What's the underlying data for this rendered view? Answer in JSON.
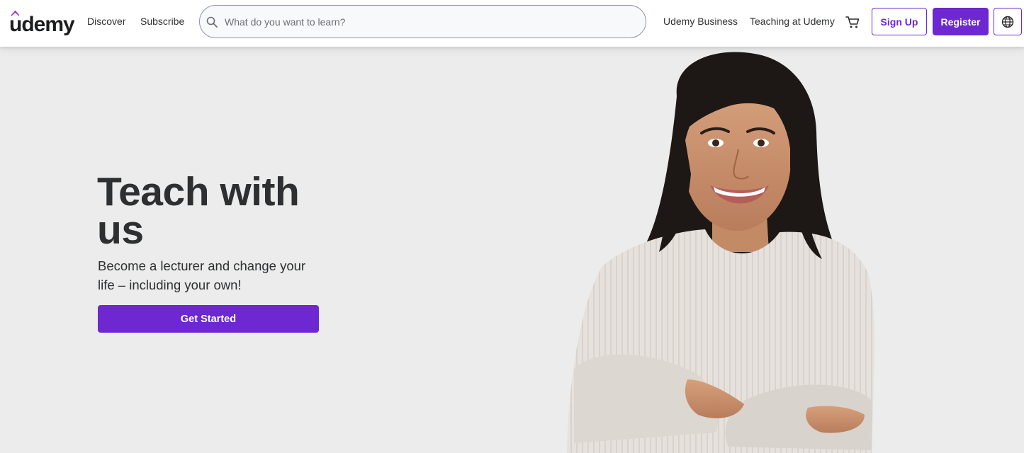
{
  "header": {
    "logo_text": "udemy",
    "nav": {
      "discover": "Discover",
      "subscribe": "Subscribe",
      "udemy_business": "Udemy Business",
      "teaching": "Teaching at Udemy"
    },
    "search": {
      "placeholder": "What do you want to learn?",
      "value": ""
    },
    "sign_up": "Sign Up",
    "register": "Register",
    "icons": {
      "search": "search-icon",
      "cart": "cart-icon",
      "language": "globe-icon"
    }
  },
  "hero": {
    "title": "Teach with us",
    "subtitle": "Become a lecturer and change your life – including your own!",
    "cta": "Get Started",
    "image": "smiling-woman-arms-crossed"
  },
  "colors": {
    "brand": "#6d28d2",
    "text": "#2d2f31",
    "hero_bg": "#ececec",
    "header_bg": "#ffffff"
  }
}
